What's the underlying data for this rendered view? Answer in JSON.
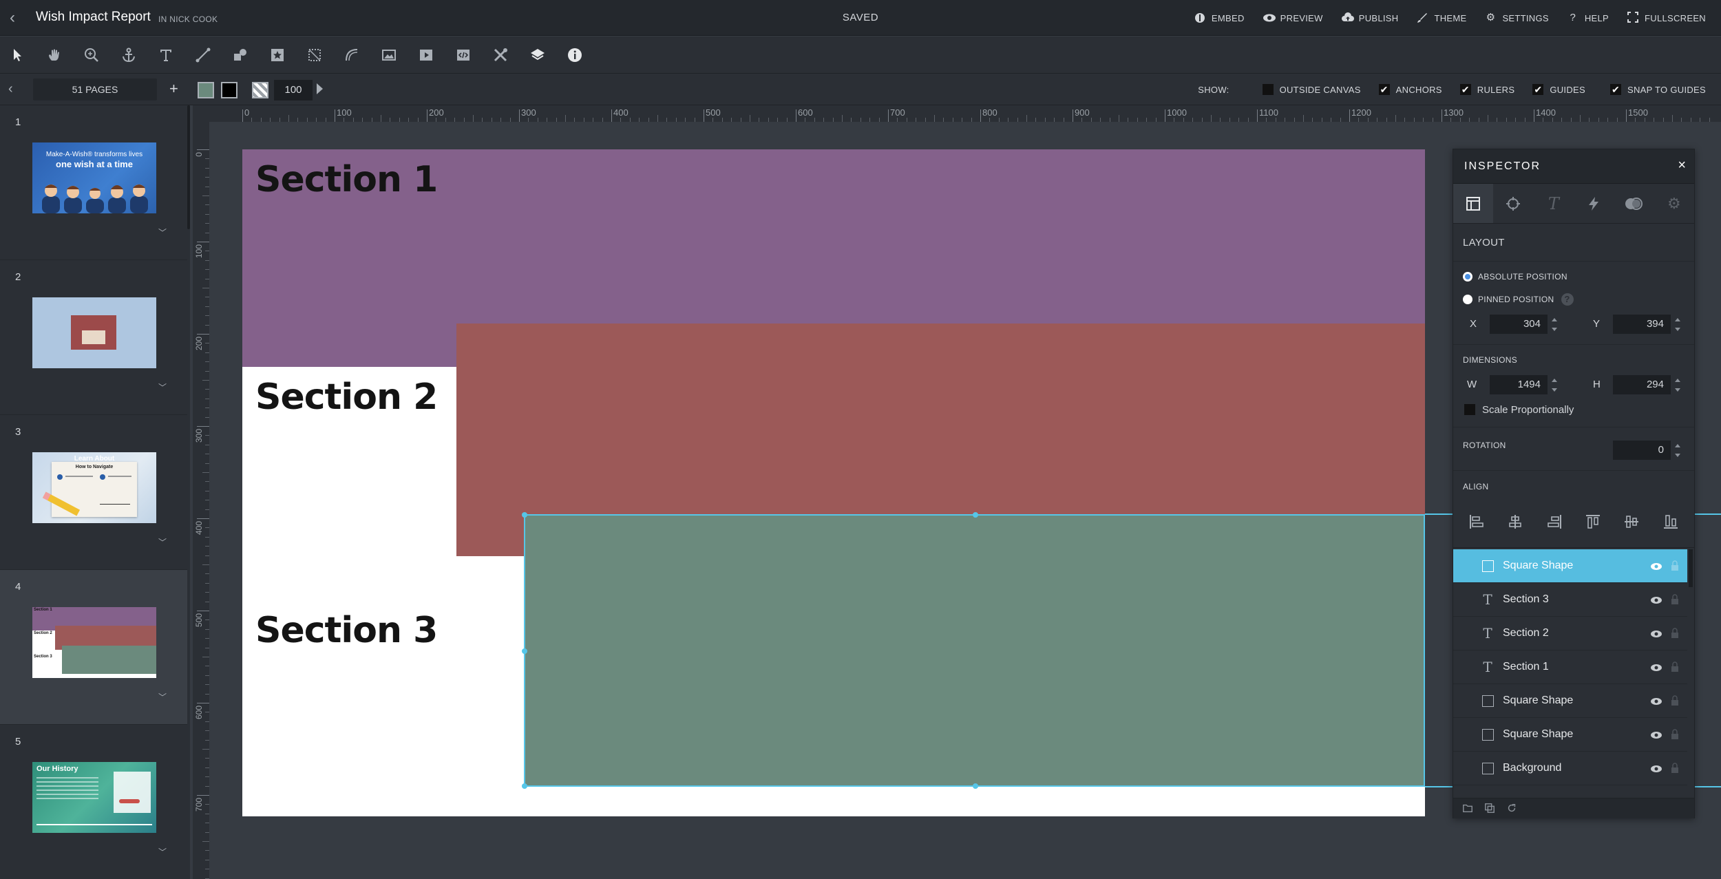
{
  "header": {
    "title": "Wish Impact Report",
    "owner": "IN NICK COOK",
    "status": "SAVED",
    "menu": [
      {
        "label": "EMBED",
        "icon": "embed-icon"
      },
      {
        "label": "PREVIEW",
        "icon": "eye-icon"
      },
      {
        "label": "PUBLISH",
        "icon": "cloud-upload-icon"
      },
      {
        "label": "THEME",
        "icon": "brush-icon"
      },
      {
        "label": "SETTINGS",
        "icon": "gear-icon"
      },
      {
        "label": "HELP",
        "icon": "question-icon"
      },
      {
        "label": "FULLSCREEN",
        "icon": "fullscreen-icon"
      }
    ]
  },
  "toolbar": {
    "tools": [
      "select-tool",
      "hand-tool",
      "zoom-tool",
      "anchor-tool",
      "text-tool",
      "line-tool",
      "shapes-tool",
      "star-tool",
      "crop-tool",
      "path-tool",
      "image-tool",
      "video-tool",
      "embed-code-tool",
      "utilities-tool",
      "layers-tool",
      "info-tool"
    ]
  },
  "subbar": {
    "pages_count": "51 PAGES",
    "add": "+",
    "fill_color": "#6b8a7d",
    "stroke_color": "#000000",
    "opacity": "100",
    "show_label": "SHOW:",
    "options": [
      {
        "label": "OUTSIDE CANVAS",
        "checked": false
      },
      {
        "label": "ANCHORS",
        "checked": true
      },
      {
        "label": "RULERS",
        "checked": true
      },
      {
        "label": "GUIDES",
        "checked": true
      },
      {
        "label": "SNAP TO GUIDES",
        "checked": true
      }
    ]
  },
  "pages": [
    {
      "num": "1",
      "thumb_title": "Make-A-Wish® transforms lives",
      "thumb_subtitle": "one wish at a time"
    },
    {
      "num": "2"
    },
    {
      "num": "3",
      "thumb_title": "Learn About",
      "thumb_subtitle": "How to Navigate"
    },
    {
      "num": "4"
    },
    {
      "num": "5",
      "thumb_title": "Our History"
    }
  ],
  "ruler": {
    "h_labels": [
      "0",
      "100",
      "200",
      "300",
      "400",
      "500",
      "600",
      "700",
      "800",
      "900",
      "1000",
      "1100",
      "1200",
      "1300",
      "1400",
      "1500"
    ],
    "v_labels": [
      "0",
      "100",
      "200",
      "300",
      "400",
      "500",
      "600",
      "700"
    ]
  },
  "slide": {
    "section1": "Section 1",
    "section2": "Section 2",
    "section3": "Section 3",
    "colors": {
      "purple": "#84618b",
      "red": "#9c5958",
      "green": "#6b8a7d"
    }
  },
  "inspector": {
    "title": "INSPECTOR",
    "close": "×",
    "tabs": [
      "layout-tab",
      "style-tab",
      "text-tab",
      "actions-tab",
      "effects-tab",
      "settings-tab"
    ],
    "section": "LAYOUT",
    "absolute_label": "ABSOLUTE POSITION",
    "pinned_label": "PINNED POSITION",
    "x_label": "X",
    "x": "304",
    "y_label": "Y",
    "y": "394",
    "dimensions_label": "DIMENSIONS",
    "w_label": "W",
    "w": "1494",
    "h_label": "H",
    "h": "294",
    "scale_label": "Scale Proportionally",
    "rotation_label": "ROTATION",
    "rotation": "0",
    "align_label": "ALIGN",
    "layers": [
      {
        "name": "Square Shape",
        "type": "shape",
        "selected": true
      },
      {
        "name": "Section 3",
        "type": "text"
      },
      {
        "name": "Section 2",
        "type": "text"
      },
      {
        "name": "Section 1",
        "type": "text"
      },
      {
        "name": "Square Shape",
        "type": "shape"
      },
      {
        "name": "Square Shape",
        "type": "shape"
      },
      {
        "name": "Background",
        "type": "shape"
      }
    ]
  }
}
